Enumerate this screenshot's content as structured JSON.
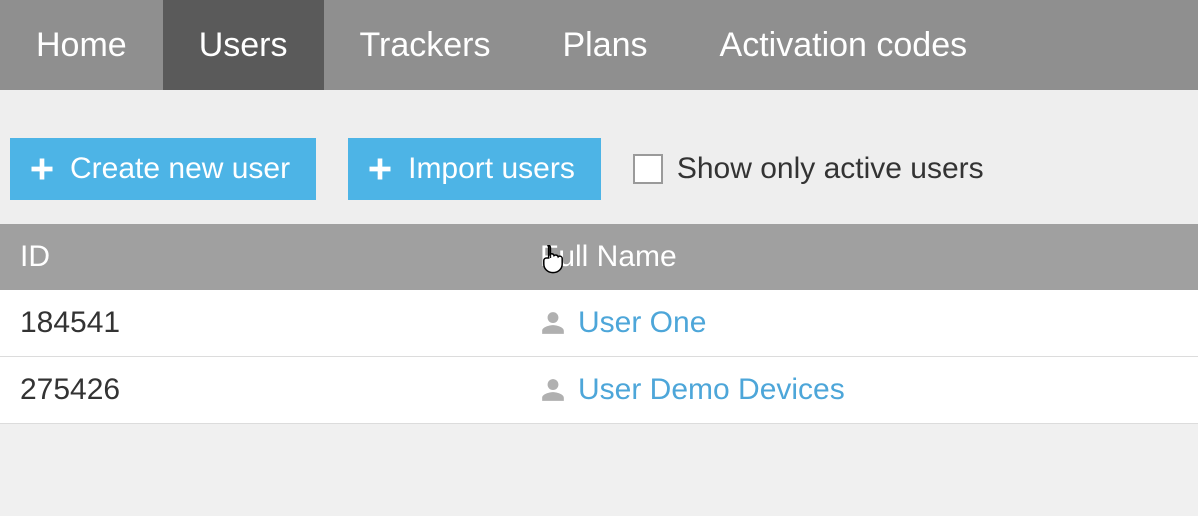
{
  "nav": {
    "items": [
      {
        "label": "Home",
        "active": false
      },
      {
        "label": "Users",
        "active": true
      },
      {
        "label": "Trackers",
        "active": false
      },
      {
        "label": "Plans",
        "active": false
      },
      {
        "label": "Activation codes",
        "active": false
      }
    ]
  },
  "toolbar": {
    "create_label": "Create new user",
    "import_label": "Import users",
    "show_active_label": "Show only active users",
    "show_active_checked": false
  },
  "table": {
    "headers": {
      "id": "ID",
      "name": "Full Name"
    },
    "rows": [
      {
        "id": "184541",
        "name": "User One"
      },
      {
        "id": "275426",
        "name": "User Demo Devices"
      }
    ]
  },
  "colors": {
    "accent": "#4db4e6",
    "link": "#4da6d9",
    "nav_bg": "#8f8f8f",
    "nav_active_bg": "#5a5a5a",
    "header_bg": "#a0a0a0"
  }
}
